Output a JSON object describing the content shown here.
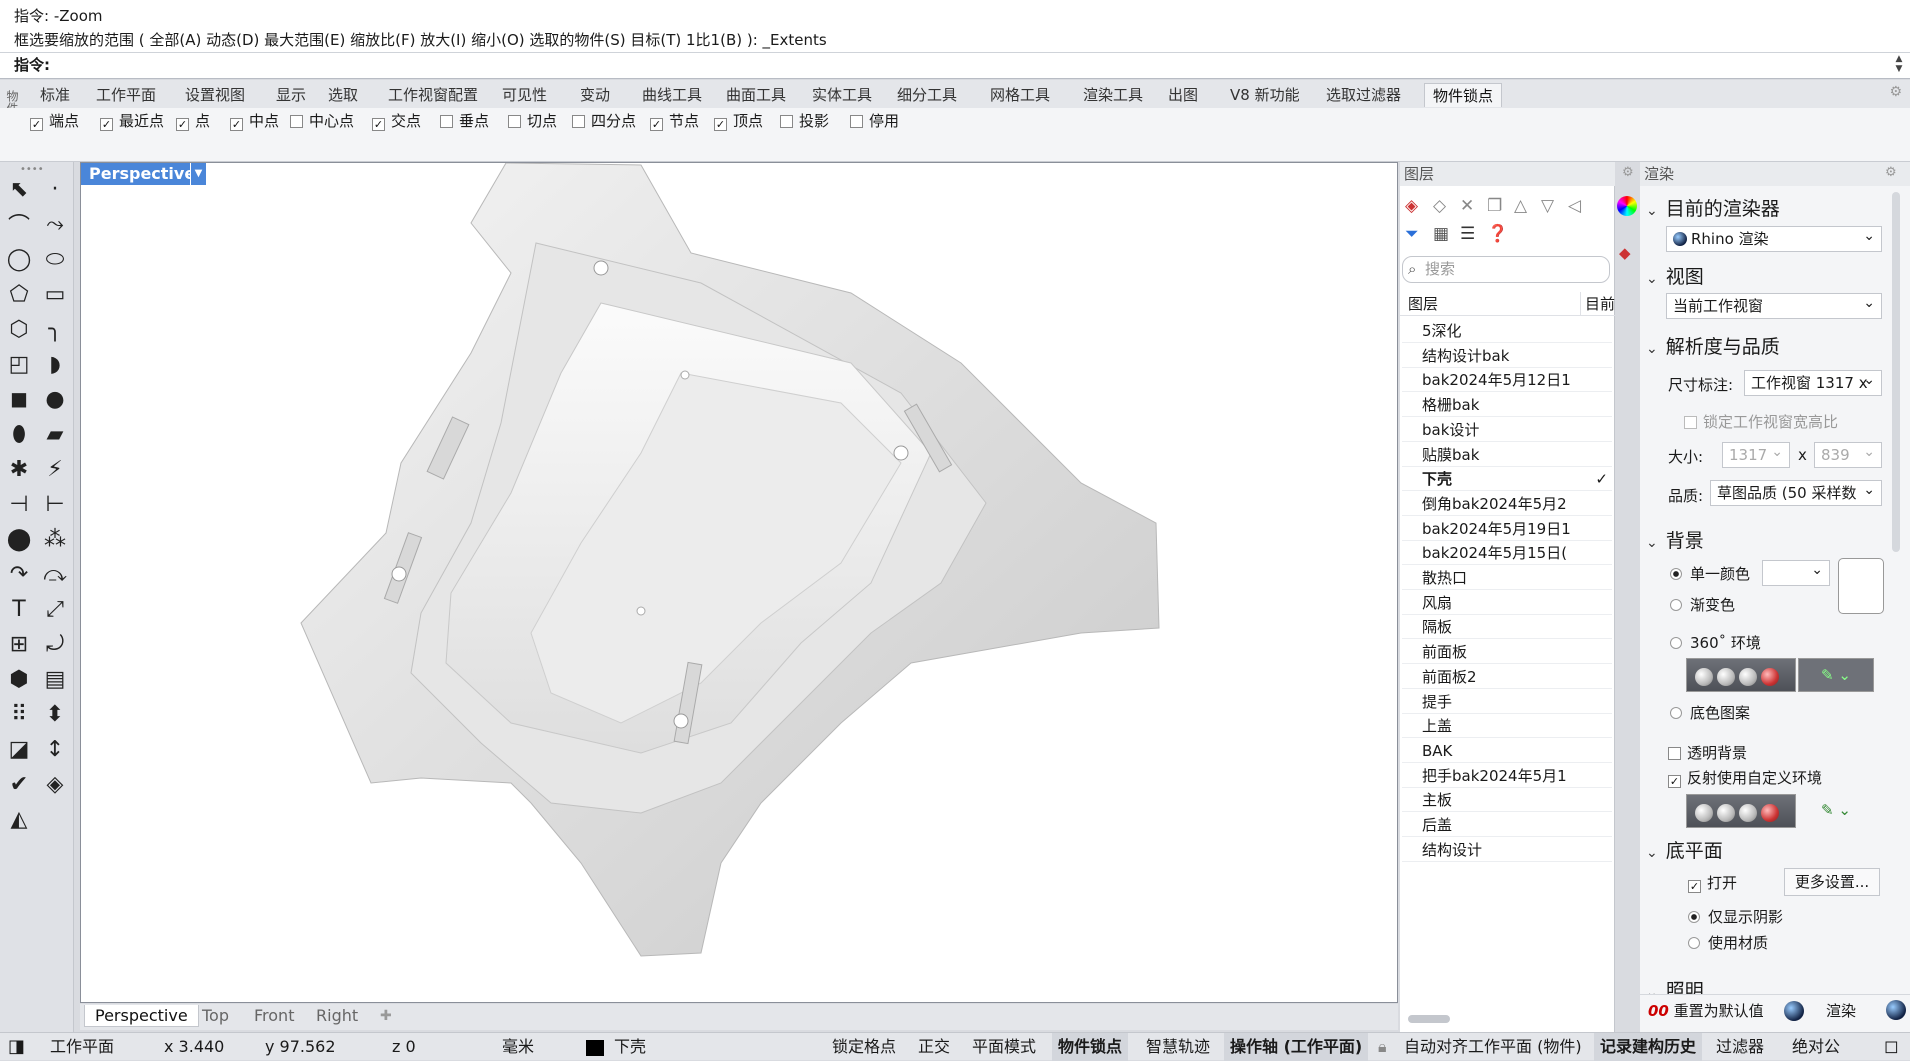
{
  "command": {
    "history_line1": "指令: -Zoom",
    "history_line2": "框选要缩放的范围 ( 全部(A)  动态(D)  最大范围(E)  缩放比(F)  放大(I)  缩小(O)  选取的物件(S)  目标(T)  1比1(B) ): _Extents",
    "prompt_label": "指令:",
    "prompt_value": ""
  },
  "side_panel_label": "物件锁点",
  "toolbar_tabs": [
    "标准",
    "工作平面",
    "设置视图",
    "显示",
    "选取",
    "工作视窗配置",
    "可见性",
    "变动",
    "曲线工具",
    "曲面工具",
    "实体工具",
    "细分工具",
    "网格工具",
    "渲染工具",
    "出图",
    "V8 新功能",
    "选取过滤器",
    "物件锁点"
  ],
  "active_tab": "物件锁点",
  "osnaps": [
    {
      "label": "端点",
      "checked": true
    },
    {
      "label": "最近点",
      "checked": true
    },
    {
      "label": "点",
      "checked": true
    },
    {
      "label": "中点",
      "checked": true
    },
    {
      "label": "中心点",
      "checked": false
    },
    {
      "label": "交点",
      "checked": true
    },
    {
      "label": "垂点",
      "checked": false
    },
    {
      "label": "切点",
      "checked": false
    },
    {
      "label": "四分点",
      "checked": false
    },
    {
      "label": "节点",
      "checked": true
    },
    {
      "label": "顶点",
      "checked": true
    },
    {
      "label": "投影",
      "checked": false
    },
    {
      "label": "停用",
      "checked": false
    }
  ],
  "viewport": {
    "label": "Perspective",
    "tabs": [
      "Perspective",
      "Top",
      "Front",
      "Right"
    ],
    "active_tab": "Perspective"
  },
  "layers_panel": {
    "title": "图层",
    "search_placeholder": "搜索",
    "col_name": "图层",
    "col_current": "目前",
    "current_layer": "下壳",
    "items": [
      "5深化",
      "结构设计bak",
      "bak2024年5月12日1",
      "格栅bak",
      "bak设计",
      "贴膜bak",
      "下壳",
      "倒角bak2024年5月2",
      "bak2024年5月19日1",
      "bak2024年5月15日(",
      "散热口",
      "风扇",
      "隔板",
      "前面板",
      "前面板2",
      "提手",
      "上盖",
      "BAK",
      "把手bak2024年5月1",
      "主板",
      "后盖",
      "结构设计"
    ]
  },
  "render_panel": {
    "title": "渲染",
    "renderer_section": "目前的渲染器",
    "renderer_value": "Rhino 渲染",
    "view_section": "视图",
    "view_value": "当前工作视窗",
    "resolution_section": "解析度与品质",
    "size_label": "尺寸标注:",
    "size_value": "工作视窗 1317 x",
    "lock_ratio": "锁定工作视窗宽高比",
    "dim_label": "大小:",
    "width": "1317",
    "times": "x",
    "height": "839",
    "quality_label": "品质:",
    "quality_value": "草图品质 (50 采样数",
    "background_section": "背景",
    "bg_options": [
      "单一颜色",
      "渐变色",
      "360˚ 环境",
      "底色图案"
    ],
    "bg_selected": "单一颜色",
    "transparent_bg": "透明背景",
    "reflection_custom": "反射使用自定义环境",
    "ground_section": "底平面",
    "ground_on": "打开",
    "more_settings": "更多设置...",
    "shadow_only": "仅显示阴影",
    "use_material": "使用材质",
    "lighting_section": "照明",
    "reset_default": "重置为默认值",
    "render_button": "渲染"
  },
  "status": {
    "cplane": "工作平面",
    "x": "x 3.440",
    "y": "y 97.562",
    "z": "z 0",
    "unit": "毫米",
    "layer": "下壳",
    "grid_snap": "锁定格点",
    "ortho": "正交",
    "planar": "平面模式",
    "osnap": "物件锁点",
    "smarttrack": "智慧轨迹",
    "gumball": "操作轴 (工作平面)",
    "autocplane": "自动对齐工作平面 (物件)",
    "history": "记录建构历史",
    "filter": "过滤器",
    "absolute": "绝对公"
  },
  "colors": {
    "viewport_label_bg": "#4a86d9",
    "layer_swatch": "#000000",
    "reset_icon": "#cc0000"
  }
}
